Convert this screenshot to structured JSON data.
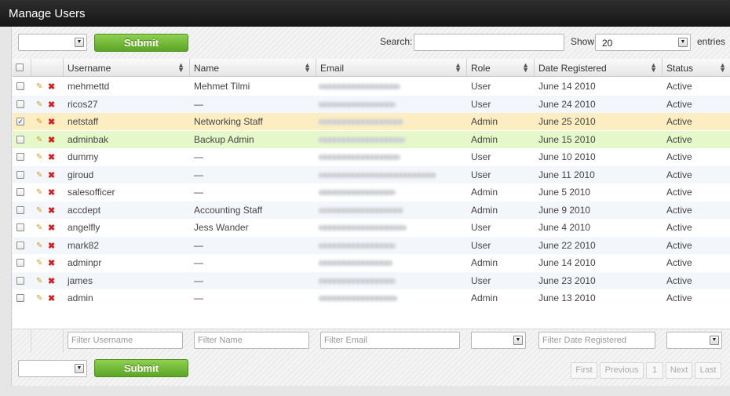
{
  "title": "Manage Users",
  "toolbar": {
    "submit": "Submit",
    "search_label": "Search:",
    "show_label": "Show",
    "show_value": "20",
    "entries_label": "entries"
  },
  "columns": [
    "Username",
    "Name",
    "Email",
    "Role",
    "Date Registered",
    "Status"
  ],
  "rows": [
    {
      "username": "mehmettd",
      "name": "Mehmet Tilmi",
      "role": "User",
      "date": "June 14 2010",
      "status": "Active",
      "checked": false
    },
    {
      "username": "ricos27",
      "name": "—",
      "role": "User",
      "date": "June 24 2010",
      "status": "Active",
      "checked": false
    },
    {
      "username": "netstaff",
      "name": "Networking Staff",
      "role": "Admin",
      "date": "June 25 2010",
      "status": "Active",
      "checked": true
    },
    {
      "username": "adminbak",
      "name": "Backup Admin",
      "role": "Admin",
      "date": "June 15 2010",
      "status": "Active",
      "checked": false
    },
    {
      "username": "dummy",
      "name": "—",
      "role": "User",
      "date": "June 10 2010",
      "status": "Active",
      "checked": false
    },
    {
      "username": "giroud",
      "name": "—",
      "role": "User",
      "date": "June 11 2010",
      "status": "Active",
      "checked": false
    },
    {
      "username": "salesofficer",
      "name": "—",
      "role": "Admin",
      "date": "June 5 2010",
      "status": "Active",
      "checked": false
    },
    {
      "username": "accdept",
      "name": "Accounting Staff",
      "role": "Admin",
      "date": "June 9 2010",
      "status": "Active",
      "checked": false
    },
    {
      "username": "angelfly",
      "name": "Jess Wander",
      "role": "User",
      "date": "June 4 2010",
      "status": "Active",
      "checked": false
    },
    {
      "username": "mark82",
      "name": "—",
      "role": "User",
      "date": "June 22 2010",
      "status": "Active",
      "checked": false
    },
    {
      "username": "adminpr",
      "name": "—",
      "role": "Admin",
      "date": "June 14 2010",
      "status": "Active",
      "checked": false
    },
    {
      "username": "james",
      "name": "—",
      "role": "User",
      "date": "June 23 2010",
      "status": "Active",
      "checked": false
    },
    {
      "username": "admin",
      "name": "—",
      "role": "Admin",
      "date": "June 13 2010",
      "status": "Active",
      "checked": false
    }
  ],
  "filters": {
    "username": "Filter Username",
    "name": "Filter Name",
    "email": "Filter Email",
    "date": "Filter Date Registered"
  },
  "pagination": {
    "first": "First",
    "previous": "Previous",
    "page": "1",
    "next": "Next",
    "last": "Last"
  },
  "colors": {
    "row_selected": "#fdedc3",
    "row_highlight": "#e4f8c9",
    "row_alt": "#f3f7fc",
    "submit": "#6cb52f",
    "header_bar": "#1f1f1f"
  }
}
